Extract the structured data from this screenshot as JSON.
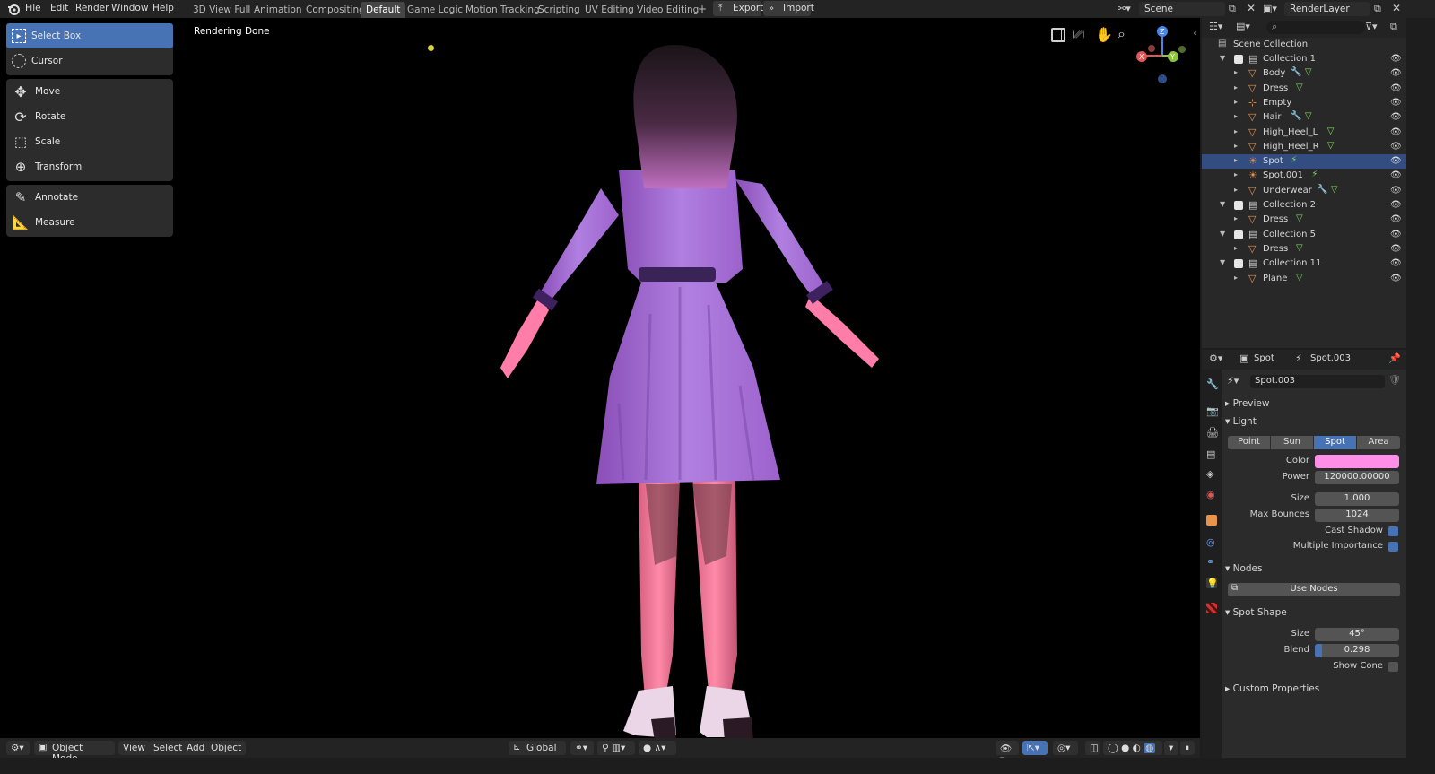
{
  "menu": [
    "File",
    "Edit",
    "Render",
    "Window",
    "Help"
  ],
  "workspaces": [
    {
      "label": "3D View Full",
      "active": false
    },
    {
      "label": "Animation",
      "active": false
    },
    {
      "label": "Compositing",
      "active": false
    },
    {
      "label": "Default",
      "active": true
    },
    {
      "label": "Game Logic",
      "active": false
    },
    {
      "label": "Motion Tracking",
      "active": false
    },
    {
      "label": "Scripting",
      "active": false
    },
    {
      "label": "UV Editing",
      "active": false
    },
    {
      "label": "Video Editing",
      "active": false
    }
  ],
  "add_workspace": "+",
  "export_label": "Export",
  "import_label": "Import",
  "scene_name": "Scene",
  "render_layer": "RenderLayer",
  "viewport": {
    "status": "Rendering Done",
    "gizmo": {
      "z": "Z",
      "y": "Y",
      "x": "X"
    }
  },
  "toolbar": [
    [
      {
        "label": "Select Box",
        "icon": "select-box-icon",
        "active": true
      },
      {
        "label": "Cursor",
        "icon": "cursor-icon",
        "active": false
      }
    ],
    [
      {
        "label": "Move",
        "icon": "move-icon",
        "active": false
      },
      {
        "label": "Rotate",
        "icon": "rotate-icon",
        "active": false
      },
      {
        "label": "Scale",
        "icon": "scale-icon",
        "active": false
      },
      {
        "label": "Transform",
        "icon": "transform-icon",
        "active": false
      }
    ],
    [
      {
        "label": "Annotate",
        "icon": "annotate-icon",
        "active": false
      },
      {
        "label": "Measure",
        "icon": "measure-icon",
        "active": false
      }
    ]
  ],
  "bottombar": {
    "mode": "Object Mode",
    "view": "View",
    "select": "Select",
    "add": "Add",
    "object": "Object",
    "orientation": "Global"
  },
  "outliner": {
    "search_placeholder": "",
    "root": "Scene Collection",
    "rows": [
      {
        "label": "Collection 1",
        "kind": "collection",
        "indent": 0,
        "selected": false
      },
      {
        "label": "Body",
        "kind": "mesh",
        "indent": 1,
        "selected": false
      },
      {
        "label": "Dress",
        "kind": "mesh",
        "indent": 1,
        "selected": false
      },
      {
        "label": "Empty",
        "kind": "empty",
        "indent": 1,
        "selected": false
      },
      {
        "label": "Hair",
        "kind": "mesh",
        "indent": 1,
        "selected": false
      },
      {
        "label": "High_Heel_L",
        "kind": "mesh",
        "indent": 1,
        "selected": false
      },
      {
        "label": "High_Heel_R",
        "kind": "mesh",
        "indent": 1,
        "selected": false
      },
      {
        "label": "Spot",
        "kind": "light",
        "indent": 1,
        "selected": true
      },
      {
        "label": "Spot.001",
        "kind": "light",
        "indent": 1,
        "selected": false
      },
      {
        "label": "Underwear",
        "kind": "mesh",
        "indent": 1,
        "selected": false
      },
      {
        "label": "Collection 2",
        "kind": "collection",
        "indent": 0,
        "selected": false
      },
      {
        "label": "Dress",
        "kind": "mesh",
        "indent": 1,
        "selected": false
      },
      {
        "label": "Collection 5",
        "kind": "collection",
        "indent": 0,
        "selected": false
      },
      {
        "label": "Dress",
        "kind": "mesh",
        "indent": 1,
        "selected": false
      },
      {
        "label": "Collection 11",
        "kind": "collection",
        "indent": 0,
        "selected": false
      },
      {
        "label": "Plane",
        "kind": "mesh",
        "indent": 1,
        "selected": false
      }
    ]
  },
  "properties": {
    "object_name": "Spot",
    "data_name": "Spot.003",
    "datablock": "Spot.003",
    "sections": {
      "preview": "Preview",
      "light": "Light",
      "nodes": "Nodes",
      "spot_shape": "Spot Shape",
      "custom": "Custom Properties"
    },
    "light_types": [
      {
        "label": "Point",
        "active": false
      },
      {
        "label": "Sun",
        "active": false
      },
      {
        "label": "Spot",
        "active": true
      },
      {
        "label": "Area",
        "active": false
      }
    ],
    "color_label": "Color",
    "color_value": "#ff8ee8",
    "power_label": "Power",
    "power_value": "120000.00000",
    "size_label": "Size",
    "size_value": "1.000",
    "max_bounces_label": "Max Bounces",
    "max_bounces_value": "1024",
    "cast_shadow_label": "Cast Shadow",
    "cast_shadow": true,
    "multiple_importance_label": "Multiple Importance",
    "multiple_importance": true,
    "use_nodes_label": "Use Nodes",
    "spot_size_label": "Size",
    "spot_size_value": "45°",
    "blend_label": "Blend",
    "blend_value": "0.298",
    "blend_fraction": 0.298,
    "show_cone_label": "Show Cone",
    "show_cone": false
  },
  "colors": {
    "accent": "#4772b3",
    "selected_row": "#334d80",
    "mesh_icon": "#e8924a",
    "modifier_icon": "#6ea4ff",
    "data_icon": "#7ddc5c"
  }
}
